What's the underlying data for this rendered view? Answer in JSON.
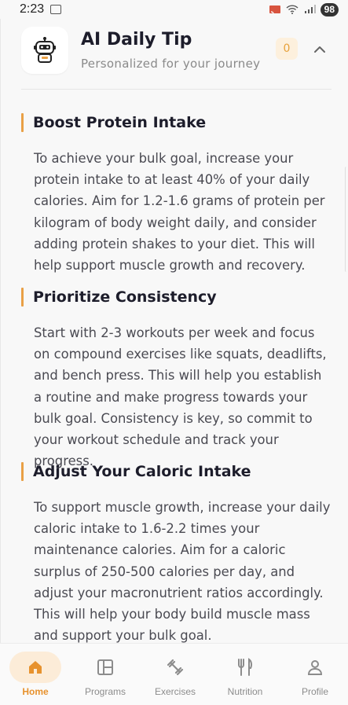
{
  "status_bar": {
    "time": "2:23",
    "battery": "98"
  },
  "header": {
    "title": "AI Daily Tip",
    "subtitle": "Personalized for your journey",
    "count": "0"
  },
  "sections": [
    {
      "title": "Boost Protein Intake",
      "body": "To achieve your bulk goal, increase your protein intake to at least 40% of your daily calories. Aim for 1.2-1.6 grams of protein per kilogram of body weight daily, and consider adding protein shakes to your diet. This will help support muscle growth and recovery."
    },
    {
      "title": "Prioritize Consistency",
      "body": "Start with 2-3 workouts per week and focus on compound exercises like squats, deadlifts, and bench press. This will help you establish a routine and make progress towards your bulk goal. Consistency is key, so commit to your workout schedule and track your progress."
    },
    {
      "title": "Adjust Your Caloric Intake",
      "body": "To support muscle growth, increase your daily caloric intake to 1.6-2.2 times your maintenance calories. Aim for a caloric surplus of 250-500 calories per day, and adjust your macronutrient ratios accordingly. This will help your body build muscle mass and support your bulk goal."
    }
  ],
  "nav": {
    "items": [
      {
        "label": "Home",
        "icon": "home-icon",
        "active": true
      },
      {
        "label": "Programs",
        "icon": "programs-icon",
        "active": false
      },
      {
        "label": "Exercises",
        "icon": "dumbbell-icon",
        "active": false
      },
      {
        "label": "Nutrition",
        "icon": "fork-knife-icon",
        "active": false
      },
      {
        "label": "Profile",
        "icon": "person-icon",
        "active": false
      }
    ]
  },
  "colors": {
    "accent": "#e9a046",
    "active_nav": "#e7922e",
    "badge_bg": "#fdf0dd"
  }
}
